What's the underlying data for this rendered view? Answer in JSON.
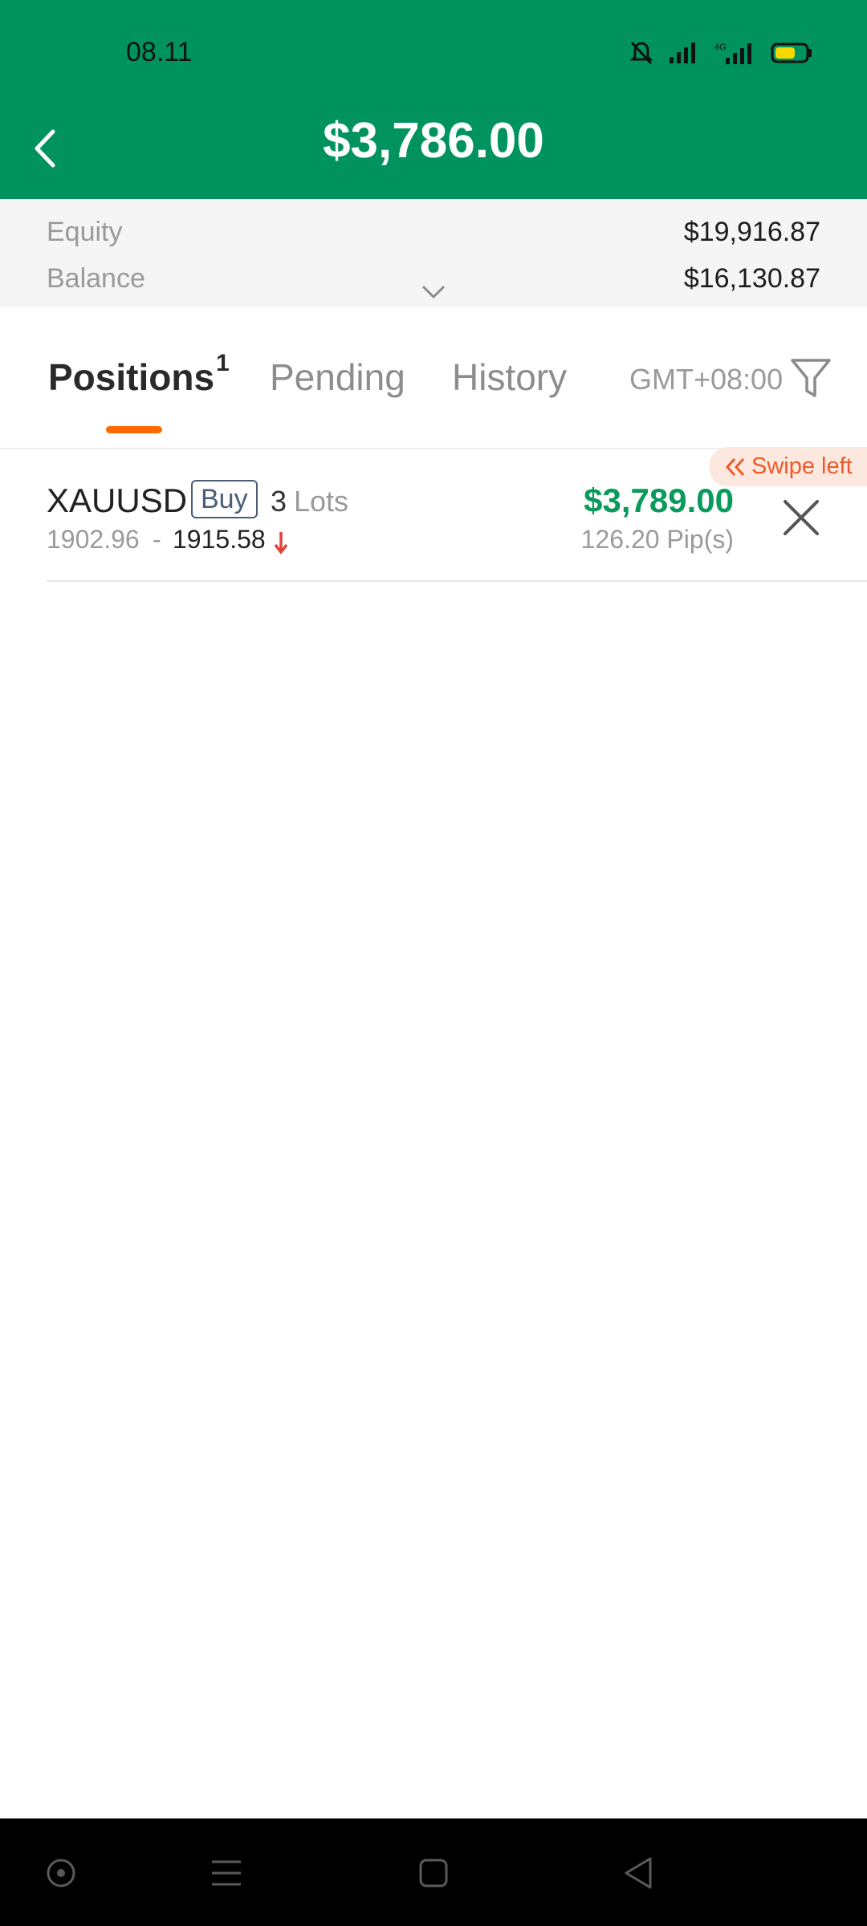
{
  "status_bar": {
    "time": "08.11"
  },
  "header": {
    "title": "$3,786.00"
  },
  "summary": {
    "equity_label": "Equity",
    "equity_value": "$19,916.87",
    "balance_label": "Balance",
    "balance_value": "$16,130.87"
  },
  "tabs": {
    "positions_label": "Positions",
    "positions_count": "1",
    "pending_label": "Pending",
    "history_label": "History",
    "timezone": "GMT+08:00"
  },
  "swipe_hint": "Swipe left",
  "position": {
    "symbol": "XAUUSD",
    "side": "Buy",
    "lots": "3",
    "lots_label": "Lots",
    "open_price": "1902.96",
    "separator": "-",
    "current_price": "1915.58",
    "profit": "$3,789.00",
    "pips": "126.20 Pip(s)"
  },
  "colors": {
    "header_bg": "#00935f",
    "accent_orange": "#ff6a00",
    "profit_green": "#0a9b5c",
    "down_red": "#e0453a"
  }
}
